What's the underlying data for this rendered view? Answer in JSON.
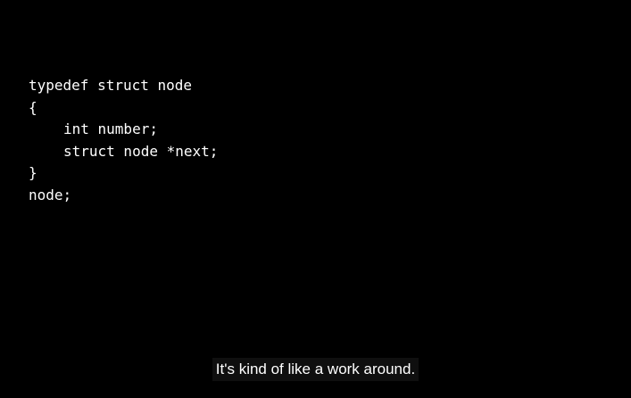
{
  "code": {
    "lines": [
      "typedef struct node",
      "{",
      "int number;",
      "struct node *next;",
      "}",
      "node;"
    ]
  },
  "caption": {
    "text": "It's kind of like a work around."
  },
  "colors": {
    "background": "#000000",
    "code_text": "#ffffff",
    "caption_text": "#ffffff",
    "caption_background": "#121212"
  }
}
